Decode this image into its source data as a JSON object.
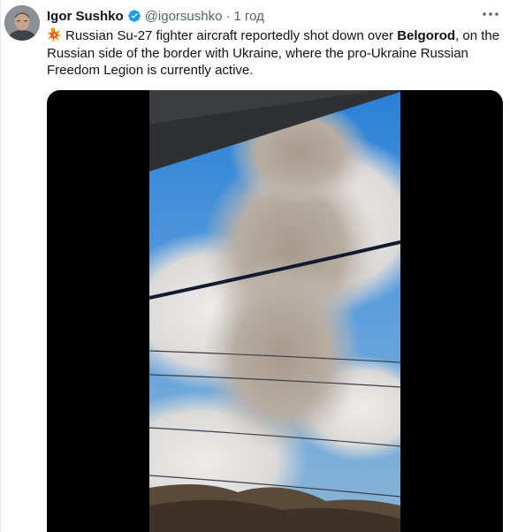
{
  "tweet": {
    "author_name": "Igor Sushko",
    "handle": "@igorsushko",
    "separator": "·",
    "time": "1 год",
    "text_part1": "Russian Su-27 fighter aircraft reportedly shot down over ",
    "text_bold": "Belgorod",
    "text_part2": ", on the Russian side of the border with Ukraine, where the pro-Ukraine Russian Freedom Legion is currently active."
  },
  "icons": {
    "verified": "verified-badge-icon",
    "more": "more-options-icon",
    "emoji": "collision-emoji-icon"
  },
  "colors": {
    "verified_blue": "#1d9bf0",
    "text_primary": "#0f1419",
    "text_secondary": "#536471"
  }
}
